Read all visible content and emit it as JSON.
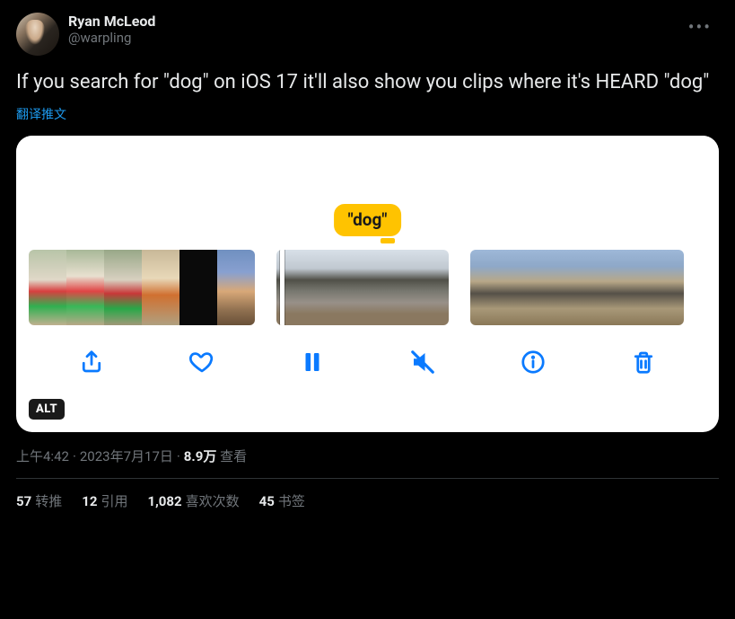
{
  "author": {
    "display_name": "Ryan McLeod",
    "handle": "@warpling"
  },
  "more_label": "•••",
  "body_text": "If you search for \"dog\" on iOS 17 it'll also show you clips where it's HEARD \"dog\"",
  "translate_label": "翻译推文",
  "media": {
    "caption_badge": "\"dog\"",
    "alt_badge": "ALT",
    "toolbar": {
      "share": "share",
      "like": "like",
      "pause": "pause",
      "mute": "mute",
      "info": "info",
      "trash": "trash"
    }
  },
  "meta": {
    "time": "上午4:42",
    "date": "2023年7月17日",
    "views_count": "8.9万",
    "views_label": "查看"
  },
  "stats": {
    "retweets_count": "57",
    "retweets_label": "转推",
    "quotes_count": "12",
    "quotes_label": "引用",
    "likes_count": "1,082",
    "likes_label": "喜欢次数",
    "bookmarks_count": "45",
    "bookmarks_label": "书签"
  }
}
